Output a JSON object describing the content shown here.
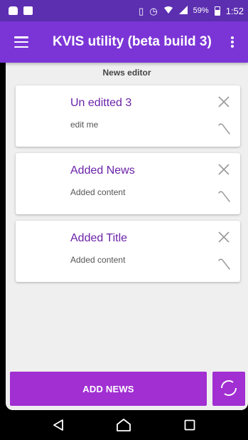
{
  "status_bar": {
    "battery_percent": "59%",
    "time": "1:52",
    "icons": [
      "app-notification-icon",
      "image-notification-icon",
      "vibrate-icon",
      "alarm-icon",
      "wifi-icon",
      "signal-icon",
      "battery-icon"
    ]
  },
  "app_bar": {
    "title": "KVIS utility (beta build 3)",
    "menu_icon": "hamburger-menu-icon",
    "overflow_icon": "more-vert-icon"
  },
  "section": {
    "title": "News editor"
  },
  "news_items": [
    {
      "title": "Un editted 3",
      "content": "edit me"
    },
    {
      "title": "Added News",
      "content": "Added content"
    },
    {
      "title": "Added Title",
      "content": "Added content"
    }
  ],
  "actions": {
    "add_news_label": "ADD NEWS",
    "refresh_icon": "refresh-icon"
  },
  "nav_bar": {
    "icons": [
      "back-icon",
      "home-icon",
      "recents-icon"
    ]
  },
  "colors": {
    "status_bar": "#5c2fb0",
    "app_bar": "#7b35d6",
    "accent": "#a12fd2",
    "card_title": "#6a22a8",
    "background": "#efefef"
  }
}
